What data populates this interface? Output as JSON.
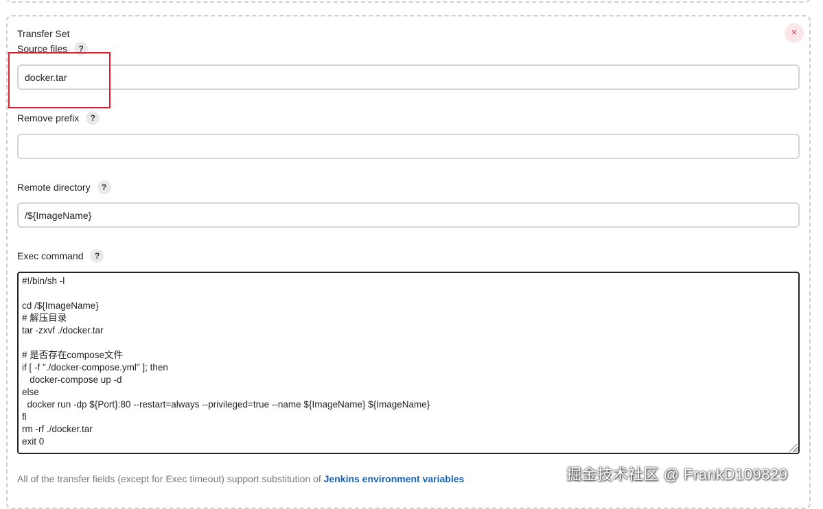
{
  "transfer_set": {
    "title": "Transfer Set",
    "close_label": "×"
  },
  "help_label": "?",
  "source_files": {
    "label": "Source files",
    "value": "docker.tar"
  },
  "remove_prefix": {
    "label": "Remove prefix",
    "value": ""
  },
  "remote_directory": {
    "label": "Remote directory",
    "value": "/${ImageName}"
  },
  "exec_command": {
    "label": "Exec command",
    "value": "#!/bin/sh -l\n\ncd /${ImageName}\n# 解压目录\ntar -zxvf ./docker.tar\n\n# 是否存在compose文件\nif [ -f \"./docker-compose.yml\" ]; then\n   docker-compose up -d\nelse\n  docker run -dp ${Port}:80 --restart=always --privileged=true --name ${ImageName} ${ImageName}\nfi\nrm -rf ./docker.tar\nexit 0"
  },
  "footer": {
    "text": "All of the transfer fields (except for Exec timeout) support substitution of ",
    "link_text": "Jenkins environment variables"
  },
  "watermark": {
    "text": "掘金技术社区 @ FrankD109829"
  },
  "colors": {
    "highlight": "#e0202c",
    "link": "#1a5fb4",
    "close_bg": "#fbe6e8",
    "close_fg": "#d24a59"
  }
}
